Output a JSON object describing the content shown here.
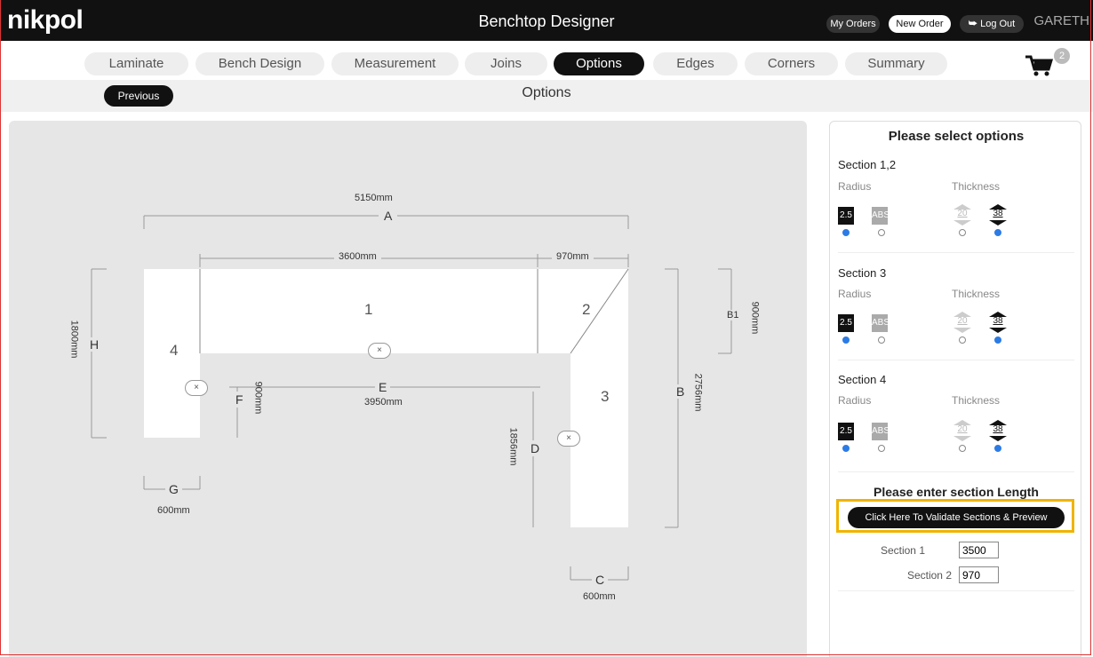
{
  "header": {
    "logo": "nikpol",
    "title": "Benchtop Designer",
    "my_orders": "My Orders",
    "new_order": "New Order",
    "log_out": "Log Out",
    "user": "GARETH"
  },
  "tabs": [
    "Laminate",
    "Bench Design",
    "Measurement",
    "Joins",
    "Options",
    "Edges",
    "Corners",
    "Summary"
  ],
  "active_tab": "Options",
  "cart": {
    "count": "2"
  },
  "subbar": {
    "previous": "Previous",
    "title": "Options"
  },
  "diagram": {
    "dim_A": "5150mm",
    "label_A": "A",
    "dim_top1": "3600mm",
    "dim_top2": "970mm",
    "dim_H": "1800mm",
    "label_H": "H",
    "dim_B1": "900mm",
    "label_B1": "B1",
    "dim_B": "2756mm",
    "label_B": "B",
    "dim_E": "3950mm",
    "label_E": "E",
    "dim_F": "900mm",
    "label_F": "F",
    "dim_D": "1856mm",
    "label_D": "D",
    "dim_G": "600mm",
    "label_G": "G",
    "dim_C": "600mm",
    "label_C": "C",
    "section_1": "1",
    "section_2": "2",
    "section_3": "3",
    "section_4": "4",
    "remove_symbol": "×"
  },
  "options": {
    "title": "Please select options",
    "radius_label": "Radius",
    "thickness_label": "Thickness",
    "sections": [
      {
        "name": "Section 1,2",
        "radius": [
          "2.5",
          "ABS"
        ],
        "thickness": [
          "20",
          "38"
        ]
      },
      {
        "name": "Section 3",
        "radius": [
          "2.5",
          "ABS"
        ],
        "thickness": [
          "20",
          "38"
        ]
      },
      {
        "name": "Section 4",
        "radius": [
          "2.5",
          "ABS"
        ],
        "thickness": [
          "20",
          "38"
        ]
      }
    ],
    "length_title": "Please enter section Length",
    "validate_button": "Click Here To Validate Sections & Preview",
    "fields": [
      {
        "label": "Section 1",
        "value": "3500"
      },
      {
        "label": "Section 2",
        "value": "970"
      }
    ]
  },
  "colors": {
    "accent_highlight": "#f0b400",
    "radio_selected": "#2c7be5",
    "header_bg": "#111111"
  }
}
